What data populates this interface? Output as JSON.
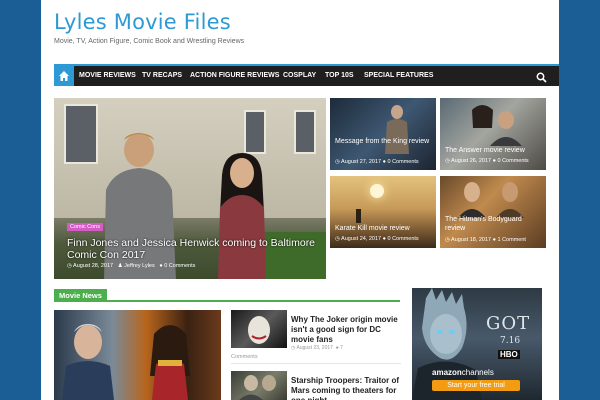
{
  "site": {
    "title": "Lyles Movie Files",
    "tagline": "Movie, TV, Action Figure, Comic Book and Wrestling Reviews"
  },
  "nav": {
    "items": [
      "MOVIE REVIEWS",
      "TV RECAPS",
      "ACTION FIGURE REVIEWS",
      "COSPLAY",
      "TOP 10S",
      "SPECIAL FEATURES"
    ]
  },
  "featured": {
    "main": {
      "category": "Comic Cons",
      "title": "Finn Jones and Jessica Henwick coming to Baltimore Comic Con 2017",
      "date": "August 28, 2017",
      "author": "Jeffrey Lyles",
      "comments": "0 Comments"
    },
    "tiles": [
      {
        "title": "Message from the King review",
        "date": "August 27, 2017",
        "comments": "0 Comments"
      },
      {
        "title": "The Answer movie review",
        "date": "August 26, 2017",
        "comments": "0 Comments"
      },
      {
        "title": "Karate Kill movie review",
        "date": "August 24, 2017",
        "comments": "0 Comments"
      },
      {
        "title": "The Hitman's Bodyguard review",
        "date": "August 18, 2017",
        "comments": "1 Comment"
      }
    ]
  },
  "movie_news": {
    "heading": "Movie News",
    "items": [
      {
        "title": "Why The Joker origin movie isn't a good sign for DC movie fans",
        "date": "August 23, 2017",
        "comments_count": "7",
        "comments_label": "Comments"
      },
      {
        "title": "Starship Troopers: Traitor of Mars coming to theaters for one night"
      }
    ]
  },
  "ad": {
    "got": "GOT",
    "date": "7.16",
    "network": "HBO",
    "brand": "amazon",
    "channel": "channels",
    "cta": "Start your free trial"
  },
  "colors": {
    "accent": "#2d9ad6",
    "nav_bg": "#1f1f1f",
    "news_green": "#4cae4c",
    "badge_pink": "#d45ac4",
    "page_bg": "#1b5e96",
    "cta_orange": "#f39c12"
  },
  "icons": {
    "nav_home": "home-icon",
    "nav_search": "search-icon",
    "meta_date": "clock-icon",
    "meta_comments": "comment-icon",
    "meta_author": "user-icon"
  }
}
